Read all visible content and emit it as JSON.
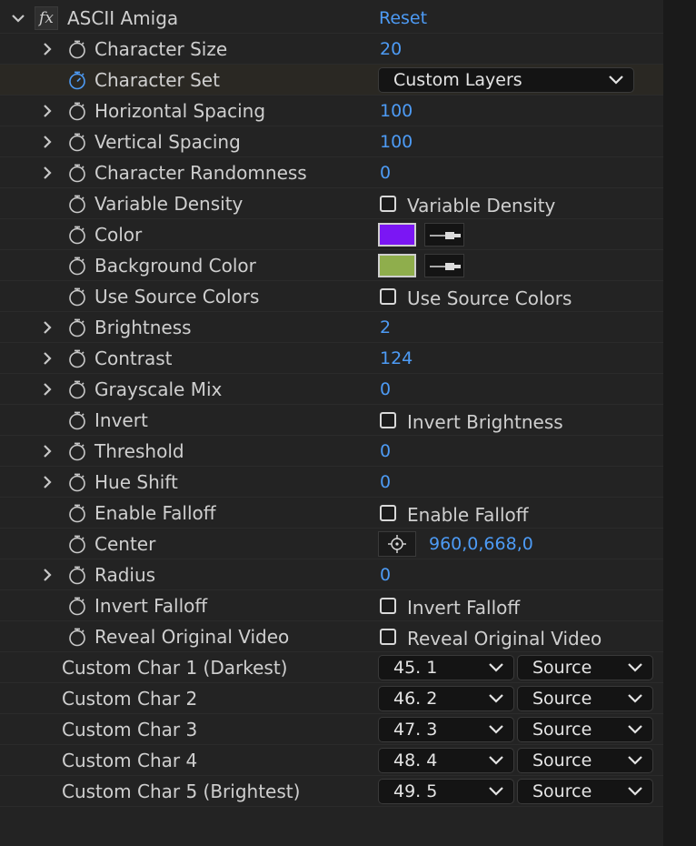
{
  "effect": {
    "name": "ASCII Amiga",
    "fx_glyph": "fx",
    "reset_label": "Reset"
  },
  "props": {
    "character_size": {
      "label": "Character Size",
      "value": "20"
    },
    "character_set": {
      "label": "Character Set",
      "value": "Custom Layers"
    },
    "horizontal_spacing": {
      "label": "Horizontal Spacing",
      "value": "100"
    },
    "vertical_spacing": {
      "label": "Vertical Spacing",
      "value": "100"
    },
    "character_randomness": {
      "label": "Character Randomness",
      "value": "0"
    },
    "variable_density": {
      "label": "Variable Density",
      "checkbox_label": "Variable Density"
    },
    "color": {
      "label": "Color",
      "swatch": "#7b16f4"
    },
    "background_color": {
      "label": "Background Color",
      "swatch": "#8fae4c"
    },
    "use_source_colors": {
      "label": "Use Source Colors",
      "checkbox_label": "Use Source Colors"
    },
    "brightness": {
      "label": "Brightness",
      "value": "2"
    },
    "contrast": {
      "label": "Contrast",
      "value": "124"
    },
    "grayscale_mix": {
      "label": "Grayscale Mix",
      "value": "0"
    },
    "invert": {
      "label": "Invert",
      "checkbox_label": "Invert Brightness"
    },
    "threshold": {
      "label": "Threshold",
      "value": "0"
    },
    "hue_shift": {
      "label": "Hue Shift",
      "value": "0"
    },
    "enable_falloff": {
      "label": "Enable Falloff",
      "checkbox_label": "Enable Falloff"
    },
    "center": {
      "label": "Center",
      "value": "960,0,668,0"
    },
    "radius": {
      "label": "Radius",
      "value": "0"
    },
    "invert_falloff": {
      "label": "Invert Falloff",
      "checkbox_label": "Invert Falloff"
    },
    "reveal_original_video": {
      "label": "Reveal Original Video",
      "checkbox_label": "Reveal Original Video"
    }
  },
  "custom_chars": [
    {
      "label": "Custom Char 1 (Darkest)",
      "layer": "45. 1",
      "source": "Source"
    },
    {
      "label": "Custom Char 2",
      "layer": "46. 2",
      "source": "Source"
    },
    {
      "label": "Custom Char 3",
      "layer": "47. 3",
      "source": "Source"
    },
    {
      "label": "Custom Char 4",
      "layer": "48. 4",
      "source": "Source"
    },
    {
      "label": "Custom Char 5 (Brightest)",
      "layer": "49. 5",
      "source": "Source"
    }
  ],
  "colors": {
    "accent_value": "#4d9bf5",
    "panel_bg": "#232323"
  }
}
